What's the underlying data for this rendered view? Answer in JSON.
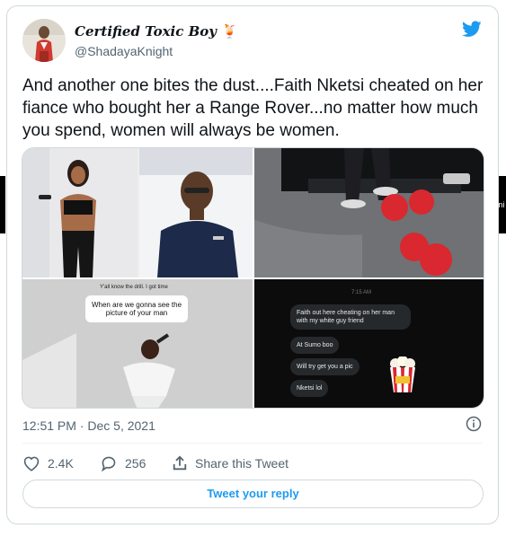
{
  "author": {
    "name": "Certified Toxic Boy",
    "handle": "@ShadayaKnight"
  },
  "tweet": {
    "text": "And another one bites the dust....Faith Nketsi cheated on her fiance who bought her a Range Rover...no matter how much you spend, women will always be women."
  },
  "media": {
    "q3": {
      "top_text": "Y'all know the drill. I got time",
      "question": "When are we gonna see the picture of your man"
    },
    "q4": {
      "time": "7:15 AM",
      "messages": [
        "Faith out here cheating on her man with my white guy friend",
        "At Sumo boo",
        "Will try get you a pic",
        "Nketsi lol"
      ]
    }
  },
  "meta": {
    "timestamp": "12:51 PM · Dec 5, 2021"
  },
  "actions": {
    "likes": "2.4K",
    "replies": "256",
    "share_label": "Share this Tweet"
  },
  "reply_button": "Tweet your reply",
  "colors": {
    "accent": "#1d9bf0",
    "text": "#0f1419",
    "muted": "#536471",
    "border": "#cfd9de"
  }
}
